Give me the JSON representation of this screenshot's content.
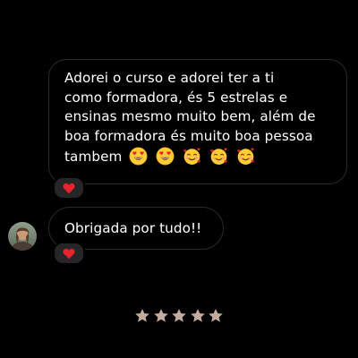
{
  "conversation": {
    "messages": [
      {
        "sender": "other",
        "lines": [
          "Adorei o curso e adorei ter a ti",
          "como formadora, és 5 estrelas e",
          "ensinas mesmo muito bem, além de",
          "boa formadora és muito boa pessoa",
          "tambem"
        ],
        "emojis": [
          "heart-eyes-emoji",
          "heart-eyes-emoji",
          "smiling-face-with-hearts-emoji",
          "smiling-face-with-hearts-emoji",
          "smiling-face-with-hearts-emoji"
        ],
        "reaction": "red-heart-icon"
      },
      {
        "sender": "other",
        "text": "Obrigada por tudo!!",
        "reaction": "red-heart-icon"
      }
    ]
  },
  "rating": {
    "stars": 5,
    "max": 5,
    "icon": "star-icon",
    "color": "#c3ab9e"
  },
  "colors": {
    "background": "#000000",
    "bubble_border": "#2a2a2c",
    "text": "#ffffff",
    "reaction_bg": "#262628",
    "heart": "#e8232e",
    "emoji_face": "#ffcc33"
  }
}
